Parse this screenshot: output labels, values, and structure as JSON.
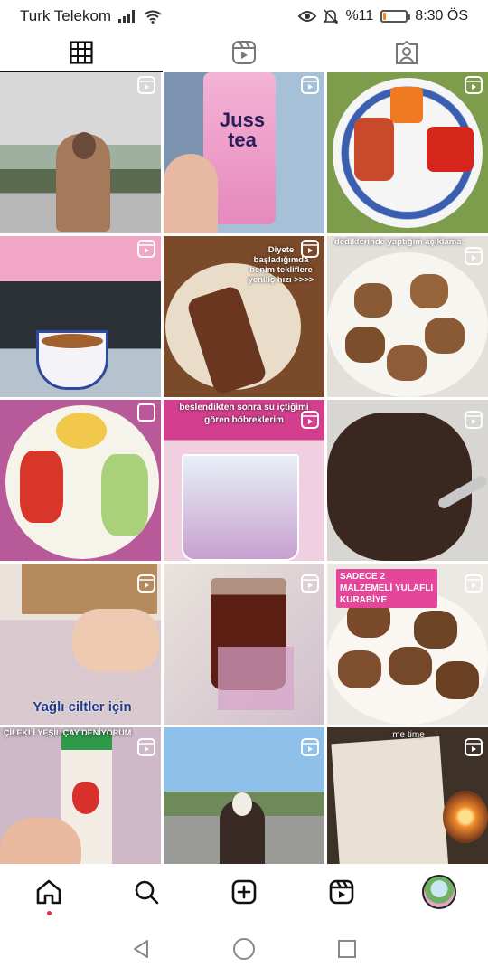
{
  "status_bar": {
    "carrier": "Turk Telekom",
    "battery_percent": "%11",
    "battery_level": 0.11,
    "time": "8:30 ÖS"
  },
  "profile_tabs": [
    {
      "name": "grid-icon",
      "active": true
    },
    {
      "name": "reels-icon",
      "active": false
    },
    {
      "name": "tagged-icon",
      "active": false
    }
  ],
  "grid": [
    {
      "type": "reel",
      "caption": ""
    },
    {
      "type": "reel",
      "caption": "Juss tea"
    },
    {
      "type": "reel",
      "caption": ""
    },
    {
      "type": "reel",
      "caption": ""
    },
    {
      "type": "reel",
      "caption": "Diyete başladığımda benim tekliflere yeniliş hızı >>>>"
    },
    {
      "type": "reel",
      "caption": "dediklerinde yaptığım açıklama:"
    },
    {
      "type": "post",
      "caption": ""
    },
    {
      "type": "reel",
      "caption": "beslendikten sonra su içtiğimi gören böbreklerim"
    },
    {
      "type": "reel",
      "caption": ""
    },
    {
      "type": "reel",
      "caption": "Yağlı ciltler için"
    },
    {
      "type": "reel",
      "caption": ""
    },
    {
      "type": "reel",
      "caption": "SADECE 2 MALZEMELİ YULAFLI KURABİYE"
    },
    {
      "type": "reel",
      "caption": "ÇİLEKLİ YEŞİL ÇAY DENİYORUM"
    },
    {
      "type": "reel",
      "caption": ""
    },
    {
      "type": "reel",
      "caption": "me time"
    }
  ],
  "bottom_nav": [
    {
      "name": "home-icon"
    },
    {
      "name": "search-icon"
    },
    {
      "name": "create-icon"
    },
    {
      "name": "reels-nav-icon"
    },
    {
      "name": "profile-avatar"
    }
  ],
  "colors": {
    "active": "#111111",
    "notification": "#ee2a4a",
    "battery": "#f08a1a"
  }
}
